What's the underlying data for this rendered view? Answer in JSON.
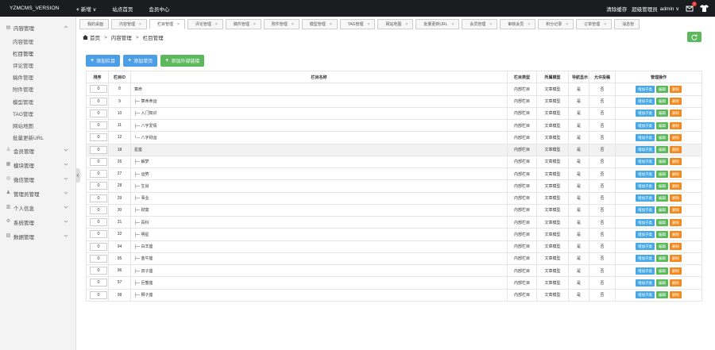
{
  "topbar": {
    "brand": "YZMCMS_VERSION",
    "nav": [
      {
        "label": "新增",
        "plus": "+",
        "chevron": "∨"
      },
      {
        "label": "站点首页"
      },
      {
        "label": "会员中心"
      }
    ],
    "clear_cache": "清除缓存",
    "role": "超级管理员",
    "user": "admin ∨",
    "badge": "2"
  },
  "sidebar": {
    "groups": [
      {
        "label": "内容管理",
        "icon": "▤",
        "open": true,
        "items": [
          "内容管理",
          "栏目管理",
          "评论管理",
          "稿件管理",
          "附件管理",
          "模型管理",
          "TAG管理",
          "网站地图",
          "批量更新URL"
        ]
      },
      {
        "label": "会员管理",
        "icon": "♙"
      },
      {
        "label": "模块管理",
        "icon": "▦"
      },
      {
        "label": "微信管理",
        "icon": "◎"
      },
      {
        "label": "管理员管理",
        "icon": "♟"
      },
      {
        "label": "个人信息",
        "icon": "▥"
      },
      {
        "label": "系统管理",
        "icon": "⚙"
      },
      {
        "label": "数据管理",
        "icon": "▧"
      }
    ]
  },
  "tabs": [
    {
      "label": "我的桌面",
      "closable": false
    },
    {
      "label": "内容管理",
      "closable": true
    },
    {
      "label": "栏目管理",
      "closable": true,
      "active": true
    },
    {
      "label": "评论管理",
      "closable": true
    },
    {
      "label": "稿件管理",
      "closable": true
    },
    {
      "label": "附件管理",
      "closable": true
    },
    {
      "label": "模型管理",
      "closable": true
    },
    {
      "label": "TAG管理",
      "closable": true
    },
    {
      "label": "网站地图",
      "closable": true
    },
    {
      "label": "批量更新URL",
      "closable": true
    },
    {
      "label": "会员管理",
      "closable": true
    },
    {
      "label": "审核会员",
      "closable": true
    },
    {
      "label": "积分记录",
      "closable": true
    },
    {
      "label": "订单管理",
      "closable": true
    },
    {
      "label": "消息管",
      "closable": false
    }
  ],
  "breadcrumb": {
    "home": "首页",
    "items": [
      "内容管理",
      "栏目管理"
    ],
    "sep": ">"
  },
  "actions": [
    "添加栏目",
    "添加单页",
    "添加外部链接"
  ],
  "table": {
    "headers": {
      "order": "排序",
      "id": "栏目ID",
      "name": "栏目名称",
      "type": "栏目类型",
      "model": "所属模型",
      "nav": "导航显示",
      "post": "允许投稿",
      "ops": "管理操作"
    },
    "op_labels": {
      "add": "增加子类",
      "edit": "编辑",
      "del": "删除"
    },
    "rows": [
      {
        "order": "0",
        "id": "8",
        "name": "算命",
        "type": "内部栏目",
        "model": "文章模型",
        "nav": "是",
        "post": "否"
      },
      {
        "order": "0",
        "id": "9",
        "name": "├─ 算命命运",
        "type": "内部栏目",
        "model": "文章模型",
        "nav": "是",
        "post": "否"
      },
      {
        "order": "0",
        "id": "10",
        "name": "├─ 入门知识",
        "type": "内部栏目",
        "model": "文章模型",
        "nav": "是",
        "post": "否"
      },
      {
        "order": "0",
        "id": "11",
        "name": "├─ 八字爱情",
        "type": "内部栏目",
        "model": "文章模型",
        "nav": "是",
        "post": "否"
      },
      {
        "order": "0",
        "id": "12",
        "name": "└─ 八字财运",
        "type": "内部栏目",
        "model": "文章模型",
        "nav": "是",
        "post": "否"
      },
      {
        "order": "0",
        "id": "18",
        "name": "星座",
        "type": "内部栏目",
        "model": "文章模型",
        "nav": "是",
        "post": "否",
        "highlight": true
      },
      {
        "order": "0",
        "id": "26",
        "name": "├─ 解梦",
        "type": "内部栏目",
        "model": "文章模型",
        "nav": "是",
        "post": "否"
      },
      {
        "order": "0",
        "id": "27",
        "name": "├─ 运势",
        "type": "内部栏目",
        "model": "文章模型",
        "nav": "是",
        "post": "否"
      },
      {
        "order": "0",
        "id": "28",
        "name": "├─ 生肖",
        "type": "内部栏目",
        "model": "文章模型",
        "nav": "是",
        "post": "否"
      },
      {
        "order": "0",
        "id": "29",
        "name": "├─ 事业",
        "type": "内部栏目",
        "model": "文章模型",
        "nav": "是",
        "post": "否"
      },
      {
        "order": "0",
        "id": "30",
        "name": "├─ 财富",
        "type": "内部栏目",
        "model": "文章模型",
        "nav": "是",
        "post": "否"
      },
      {
        "order": "0",
        "id": "31",
        "name": "├─ 百科",
        "type": "内部栏目",
        "model": "文章模型",
        "nav": "是",
        "post": "否"
      },
      {
        "order": "0",
        "id": "32",
        "name": "├─ 明星",
        "type": "内部栏目",
        "model": "文章模型",
        "nav": "是",
        "post": "否"
      },
      {
        "order": "0",
        "id": "94",
        "name": "├─ 白羊座",
        "type": "内部栏目",
        "model": "文章模型",
        "nav": "是",
        "post": "否"
      },
      {
        "order": "0",
        "id": "95",
        "name": "├─ 金牛座",
        "type": "内部栏目",
        "model": "文章模型",
        "nav": "是",
        "post": "否"
      },
      {
        "order": "0",
        "id": "96",
        "name": "├─ 双子座",
        "type": "内部栏目",
        "model": "文章模型",
        "nav": "是",
        "post": "否"
      },
      {
        "order": "0",
        "id": "97",
        "name": "├─ 巨蟹座",
        "type": "内部栏目",
        "model": "文章模型",
        "nav": "是",
        "post": "否"
      },
      {
        "order": "0",
        "id": "98",
        "name": "├─ 狮子座",
        "type": "内部栏目",
        "model": "文章模型",
        "nav": "是",
        "post": "否"
      }
    ]
  },
  "colors": {
    "topbar": "#1a1c20",
    "blue": "#4c9ee6",
    "green": "#5cb85c",
    "orange": "#f0891e"
  }
}
